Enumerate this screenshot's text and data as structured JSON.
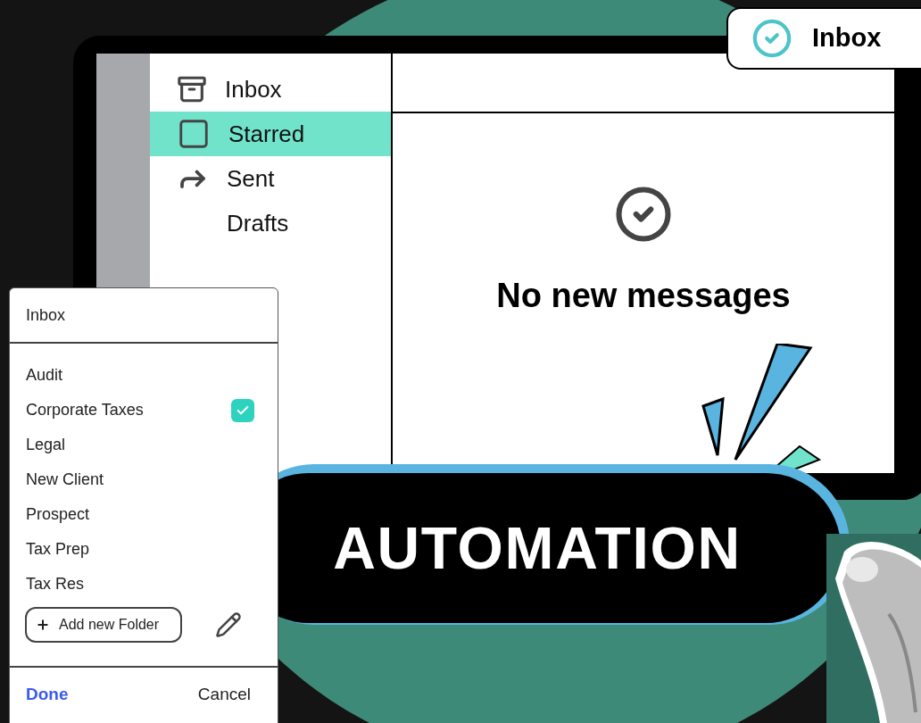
{
  "badge": {
    "label": "Inbox"
  },
  "sidebar": {
    "items": [
      {
        "label": "Inbox",
        "kind": "archive",
        "selected": false
      },
      {
        "label": "Starred",
        "kind": "square",
        "selected": true
      },
      {
        "label": "Sent",
        "kind": "forward",
        "selected": false
      },
      {
        "label": "Drafts",
        "kind": "plain",
        "selected": false
      }
    ]
  },
  "main": {
    "message": "No new messages"
  },
  "folder_panel": {
    "title": "Inbox",
    "folders": [
      {
        "label": "Audit",
        "checked": false
      },
      {
        "label": "Corporate Taxes",
        "checked": true
      },
      {
        "label": "Legal",
        "checked": false
      },
      {
        "label": "New Client",
        "checked": false
      },
      {
        "label": "Prospect",
        "checked": false
      },
      {
        "label": "Tax Prep",
        "checked": false
      },
      {
        "label": "Tax Res",
        "checked": false
      }
    ],
    "add_button": "Add new Folder",
    "done": "Done",
    "cancel": "Cancel"
  },
  "banner": {
    "label": "AUTOMATION"
  }
}
